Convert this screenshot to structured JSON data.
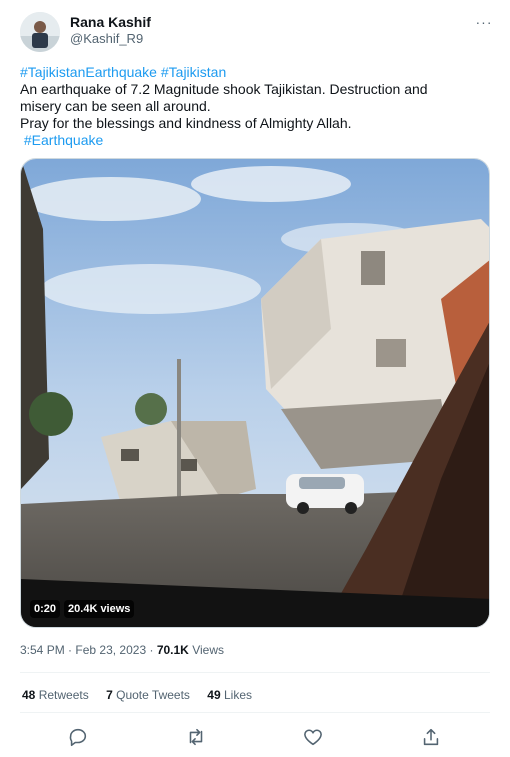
{
  "author": {
    "name": "Rana Kashif",
    "handle": "@Kashif_R9"
  },
  "tweet": {
    "line1": "#TajikistanEarthquake #Tajikistan",
    "hashtag_1": "#TajikistanEarthquake",
    "hashtag_2": "#Tajikistan",
    "line2": "An earthquake of 7.2 Magnitude shook Tajikistan. Destruction and",
    "line3": "misery can be seen all around.",
    "line4": "Pray for the blessings and kindness of Almighty Allah.",
    "hashtag_3": "#Earthquake"
  },
  "video": {
    "duration": "0:20",
    "views": "20.4K views"
  },
  "meta": {
    "time": "3:54 PM",
    "separator": "·",
    "date": "Feb 23, 2023",
    "views_count": "70.1K",
    "views_label": "Views"
  },
  "stats": {
    "retweets_count": "48",
    "retweets_label": "Retweets",
    "quotes_count": "7",
    "quotes_label": "Quote Tweets",
    "likes_count": "49",
    "likes_label": "Likes"
  },
  "more_glyph": "···",
  "icons": [
    "more-icon",
    "reply-icon",
    "retweet-icon",
    "like-icon",
    "share-icon"
  ],
  "colors": {
    "link": "#1d9bf0",
    "secondary_text": "#536471",
    "text": "#0f1419",
    "divider": "#eff3f4"
  }
}
